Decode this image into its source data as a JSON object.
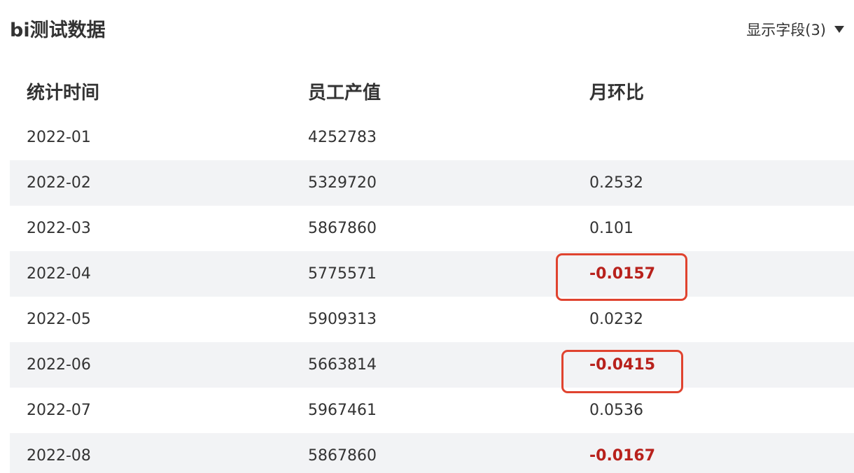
{
  "title": "bi测试数据",
  "field_toggle": {
    "label": "显示字段(3)",
    "icon": "caret-down-icon"
  },
  "table": {
    "columns": [
      "统计时间",
      "员工产值",
      "月环比"
    ],
    "rows": [
      {
        "date": "2022-01",
        "value": "4252783",
        "mom": "",
        "negative": false,
        "boxed": false
      },
      {
        "date": "2022-02",
        "value": "5329720",
        "mom": "0.2532",
        "negative": false,
        "boxed": false
      },
      {
        "date": "2022-03",
        "value": "5867860",
        "mom": "0.101",
        "negative": false,
        "boxed": false
      },
      {
        "date": "2022-04",
        "value": "5775571",
        "mom": "-0.0157",
        "negative": true,
        "boxed": true
      },
      {
        "date": "2022-05",
        "value": "5909313",
        "mom": "0.0232",
        "negative": false,
        "boxed": false
      },
      {
        "date": "2022-06",
        "value": "5663814",
        "mom": "-0.0415",
        "negative": true,
        "boxed": true
      },
      {
        "date": "2022-07",
        "value": "5967461",
        "mom": "0.0536",
        "negative": false,
        "boxed": false
      },
      {
        "date": "2022-08",
        "value": "5867860",
        "mom": "-0.0167",
        "negative": true,
        "boxed": false
      }
    ]
  },
  "colors": {
    "negative_text": "#b8211c",
    "highlight_border": "#e0432f",
    "stripe_background": "#f2f3f5"
  }
}
